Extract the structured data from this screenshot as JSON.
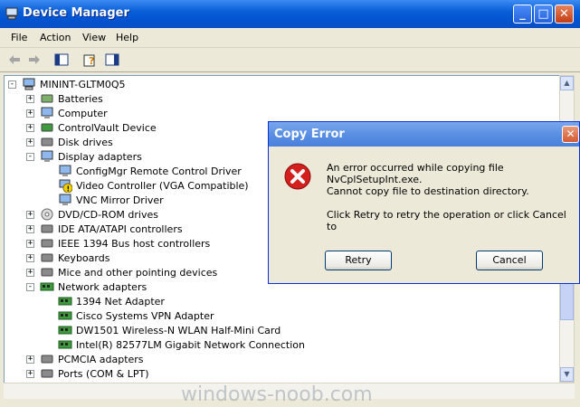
{
  "window": {
    "title": "Device Manager"
  },
  "menu": [
    "File",
    "Action",
    "View",
    "Help"
  ],
  "tree": {
    "root": "MININT-GLTM0Q5",
    "items": [
      {
        "label": "Batteries",
        "level": 1,
        "expander": "+"
      },
      {
        "label": "Computer",
        "level": 1,
        "expander": "+"
      },
      {
        "label": "ControlVault Device",
        "level": 1,
        "expander": "+"
      },
      {
        "label": "Disk drives",
        "level": 1,
        "expander": "+"
      },
      {
        "label": "Display adapters",
        "level": 1,
        "expander": "-"
      },
      {
        "label": "ConfigMgr Remote Control Driver",
        "level": 2,
        "expander": ""
      },
      {
        "label": "Video Controller (VGA Compatible)",
        "level": 2,
        "expander": ""
      },
      {
        "label": "VNC Mirror Driver",
        "level": 2,
        "expander": ""
      },
      {
        "label": "DVD/CD-ROM drives",
        "level": 1,
        "expander": "+"
      },
      {
        "label": "IDE ATA/ATAPI controllers",
        "level": 1,
        "expander": "+"
      },
      {
        "label": "IEEE 1394 Bus host controllers",
        "level": 1,
        "expander": "+"
      },
      {
        "label": "Keyboards",
        "level": 1,
        "expander": "+"
      },
      {
        "label": "Mice and other pointing devices",
        "level": 1,
        "expander": "+"
      },
      {
        "label": "Network adapters",
        "level": 1,
        "expander": "-"
      },
      {
        "label": "1394 Net Adapter",
        "level": 2,
        "expander": ""
      },
      {
        "label": "Cisco Systems VPN Adapter",
        "level": 2,
        "expander": ""
      },
      {
        "label": "DW1501 Wireless-N WLAN Half-Mini Card",
        "level": 2,
        "expander": ""
      },
      {
        "label": "Intel(R) 82577LM Gigabit Network Connection",
        "level": 2,
        "expander": ""
      },
      {
        "label": "PCMCIA adapters",
        "level": 1,
        "expander": "+"
      },
      {
        "label": "Ports (COM & LPT)",
        "level": 1,
        "expander": "+"
      }
    ]
  },
  "dialog": {
    "title": "Copy Error",
    "line1": "An error occurred while copying file NvCplSetupInt.exe.",
    "line2": "Cannot copy file to destination directory.",
    "line3": "Click Retry to retry the operation or click Cancel to",
    "retry": "Retry",
    "cancel": "Cancel"
  },
  "watermark": "windows-noob.com"
}
